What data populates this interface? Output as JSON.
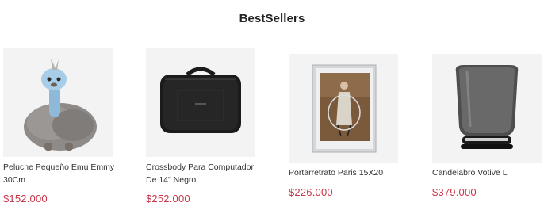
{
  "section": {
    "title": "BestSellers"
  },
  "products": [
    {
      "image_icon": "plush-emu-image",
      "name": "Peluche Pequeño Emu Emmy 30Cm",
      "price": "$152.000"
    },
    {
      "image_icon": "laptop-bag-image",
      "name": "Crossbody Para Computador De 14\" Negro",
      "price": "$252.000"
    },
    {
      "image_icon": "photo-frame-image",
      "name": "Portarretrato Paris 15X20",
      "price": "$226.000"
    },
    {
      "image_icon": "glass-candle-holder-image",
      "name": "Candelabro Votive L",
      "price": "$379.000"
    }
  ],
  "colors": {
    "price": "#c8374b",
    "thumb_bg": "#f3f3f3"
  }
}
